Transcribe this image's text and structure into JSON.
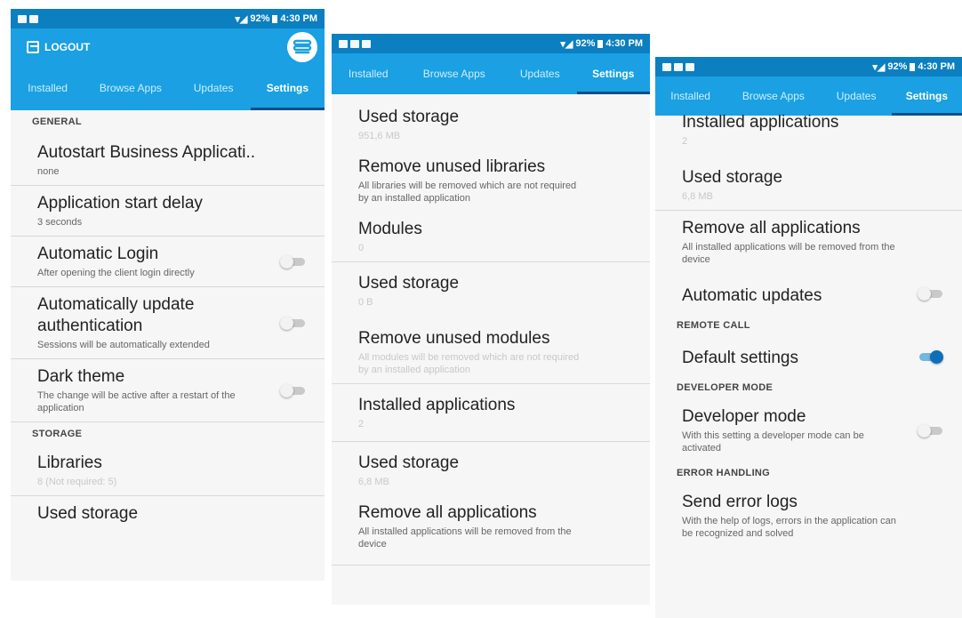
{
  "status": {
    "battery": "92%",
    "time": "4:30 PM"
  },
  "tabs": [
    {
      "label": "Installed"
    },
    {
      "label": "Browse Apps"
    },
    {
      "label": "Updates"
    },
    {
      "label": "Settings"
    }
  ],
  "p1": {
    "logout_label": "LOGOUT",
    "section_general": "GENERAL",
    "autostart_title": "Autostart Business Applicati..",
    "autostart_value": "none",
    "startdelay_title": "Application start delay",
    "startdelay_value": "3 seconds",
    "autologin_title": "Automatic Login",
    "autologin_sub": "After opening the client login directly",
    "autoupdate_auth_title": "Automatically update authentication",
    "autoupdate_auth_sub": "Sessions will be automatically extended",
    "darktheme_title": "Dark theme",
    "darktheme_sub": "The change will be active after a restart of the application",
    "section_storage": "STORAGE",
    "libraries_title": "Libraries",
    "libraries_value": "8 (Not required: 5)",
    "used_storage_title": "Used storage"
  },
  "p2": {
    "used_storage_1_title": "Used storage",
    "used_storage_1_value": "951,6 MB",
    "remove_libs_title": "Remove unused libraries",
    "remove_libs_sub": "All libraries will be removed which are not required by an installed application",
    "modules_title": "Modules",
    "modules_value": "0",
    "used_storage_2_title": "Used storage",
    "used_storage_2_value": "0 B",
    "remove_modules_title": "Remove unused modules",
    "remove_modules_sub": "All modules will be removed which are not required by an installed application",
    "installed_apps_title": "Installed applications",
    "installed_apps_value": "2",
    "used_storage_3_title": "Used storage",
    "used_storage_3_value": "6,8 MB",
    "remove_all_title": "Remove all applications",
    "remove_all_sub": "All installed applications will be removed from the device"
  },
  "p3": {
    "installed_apps_title": "Installed applications",
    "installed_apps_value": "2",
    "used_storage_title": "Used storage",
    "used_storage_value": "6,8 MB",
    "remove_all_title": "Remove all applications",
    "remove_all_sub": "All installed applications will be removed from the device",
    "auto_updates_title": "Automatic updates",
    "section_remote": "REMOTE CALL",
    "default_settings_title": "Default settings",
    "section_developer": "DEVELOPER MODE",
    "developer_title": "Developer mode",
    "developer_sub": "With this setting a developer mode can be activated",
    "section_error": "ERROR HANDLING",
    "send_logs_title": "Send error logs",
    "send_logs_sub": "With the help of logs, errors in the application can be recognized and solved"
  },
  "colors": {
    "statusbar": "#0b7fbf",
    "appbar": "#1aa0e3",
    "tab_indicator": "#0a4f8a",
    "toggle_on": "#0d6fb8"
  },
  "toggles": {
    "automatic_login": false,
    "auto_update_auth": false,
    "dark_theme": false,
    "automatic_updates": false,
    "default_settings": true,
    "developer_mode": false
  }
}
